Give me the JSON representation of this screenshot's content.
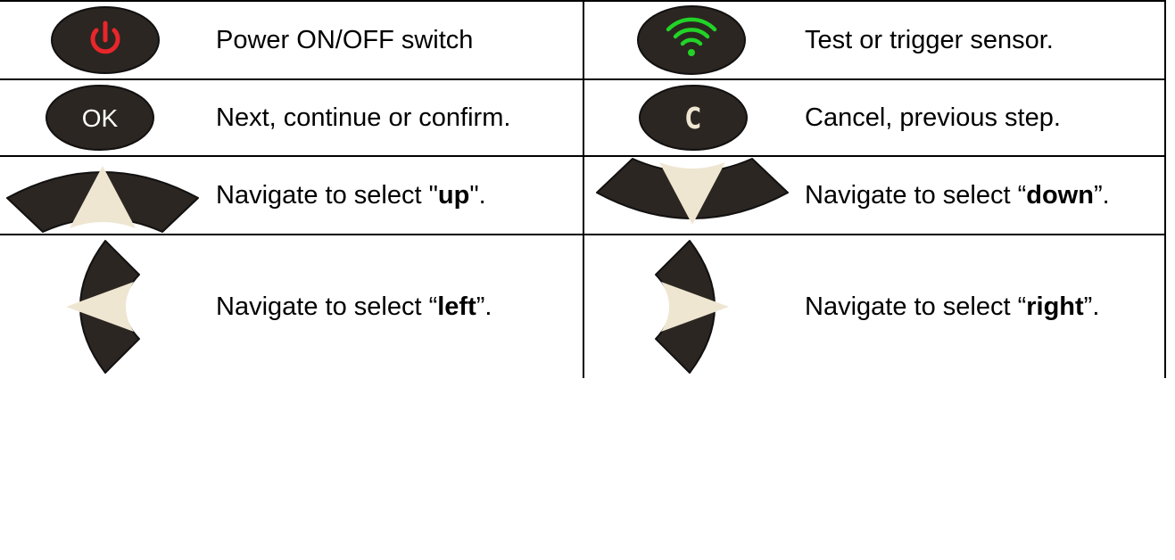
{
  "rows": [
    {
      "left": {
        "icon": "power-button-icon",
        "text": "Power ON/OFF switch"
      },
      "right": {
        "icon": "wifi-test-button-icon",
        "text": "Test or trigger sensor."
      }
    },
    {
      "left": {
        "icon": "ok-button-icon",
        "icon_text": "OK",
        "text": "Next, continue or confirm."
      },
      "right": {
        "icon": "cancel-button-icon",
        "icon_text": "C",
        "text": "Cancel, previous step."
      }
    },
    {
      "left": {
        "icon": "up-arrow-button-icon",
        "text_prefix": "Navigate to select \"",
        "text_bold": "up",
        "text_suffix": "\"."
      },
      "right": {
        "icon": "down-arrow-button-icon",
        "text_prefix": "Navigate to select “",
        "text_bold": "down",
        "text_suffix": "”."
      }
    },
    {
      "left": {
        "icon": "left-arrow-button-icon",
        "text_prefix": "Navigate to select “",
        "text_bold": "left",
        "text_suffix": "”."
      },
      "right": {
        "icon": "right-arrow-button-icon",
        "text_prefix": "Navigate to select “",
        "text_bold": "right",
        "text_suffix": "”."
      }
    }
  ],
  "colors": {
    "button_body": "#2b2621",
    "button_edge": "#121010",
    "arrow_fill": "#efe6d2",
    "power_red": "#e8262b",
    "wifi_green": "#22d327",
    "ok_text": "#ffffff",
    "cancel_text": "#efe6d2"
  }
}
